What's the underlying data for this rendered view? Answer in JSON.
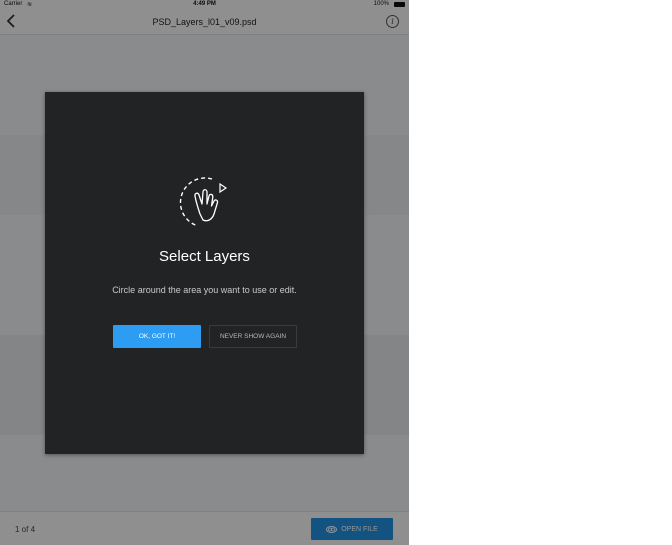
{
  "status_bar": {
    "carrier": "Carrier",
    "time": "4:49 PM",
    "battery": "100%"
  },
  "nav": {
    "title": "PSD_Layers_l01_v09.psd"
  },
  "modal": {
    "title": "Select Layers",
    "message": "Circle around the area you want to use or edit.",
    "ok_label": "OK, GOT IT!",
    "never_label": "NEVER SHOW AGAIN",
    "icon": "circle-gesture-icon"
  },
  "bottom_bar": {
    "page_counter": "1 of 4",
    "open_file_label": "OPEN FILE",
    "open_file_icon": "creative-cloud-icon"
  },
  "colors": {
    "accent": "#2d9cf3",
    "modal_bg": "#222325"
  }
}
